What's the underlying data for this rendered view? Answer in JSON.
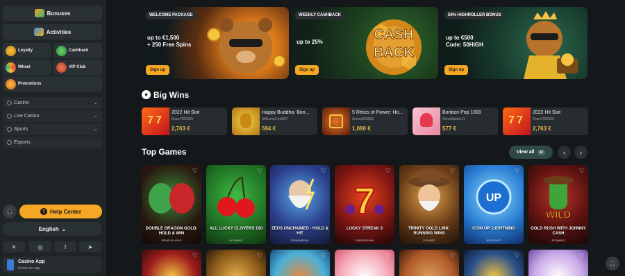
{
  "sidebar": {
    "bonuses": "Bonuses",
    "activities": "Activities",
    "loyalty": "Loyalty",
    "cashback": "Cashback",
    "wheel": "Wheel",
    "vip": "VIP Club",
    "promotions": "Promotions",
    "menu": [
      "Casino",
      "Live Casino",
      "Sports",
      "Esports"
    ],
    "help": "Help Center",
    "language": "English",
    "app_title": "Casino App",
    "app_sub": "Install our app"
  },
  "banners": [
    {
      "tag": "WELCOME PACKAGE",
      "line1": "up to €1,500",
      "line2": "+ 250 Free Spins",
      "button": "Sign up"
    },
    {
      "tag": "WEEKLY CASHBACK",
      "line1": "up to 25%",
      "line2": "",
      "art": "CASH BACK",
      "button": "Sign up"
    },
    {
      "tag": "50% HIGHROLLER BONUS",
      "line1": "up to €500",
      "line2": "Code: 50HIGH",
      "button": "Sign up"
    }
  ],
  "big_wins": {
    "title": "Big Wins",
    "items": [
      {
        "game": "2022 Hit Slot",
        "user": "Draw7050565",
        "amount": "2,763 €"
      },
      {
        "game": "Happy Buddha: Bon...",
        "user": "AllGameCool857",
        "amount": "594 €"
      },
      {
        "game": "5 Relics of Power: Ho...",
        "user": "Anime833698",
        "amount": "1,080 €"
      },
      {
        "game": "Bonbon Pop 1000",
        "user": "AdroitSpider11",
        "amount": "577 €"
      },
      {
        "game": "2022 Hit Slot",
        "user": "Draw7050565",
        "amount": "2,763 €"
      }
    ]
  },
  "top_games": {
    "title": "Top Games",
    "view_all": "View all",
    "count": "32",
    "items": [
      {
        "title": "Double Dragon Gold: Hold & Win",
        "provider": "PENGUIN KING"
      },
      {
        "title": "All Lucky Clovers 100",
        "provider": "BGAMING"
      },
      {
        "title": "Zeus Unchained - Hold & Hit",
        "provider": "SPINOMENAL"
      },
      {
        "title": "Lucky Streak 3",
        "provider": "ENDORPHINA"
      },
      {
        "title": "Trinity Gold Link: Running Wins",
        "provider": "FUGASO"
      },
      {
        "title": "Coin Up: Lightning",
        "provider": "BOOONGO"
      },
      {
        "title": "Gold Rush with Johnny Cash",
        "provider": "BGAMING"
      }
    ]
  }
}
